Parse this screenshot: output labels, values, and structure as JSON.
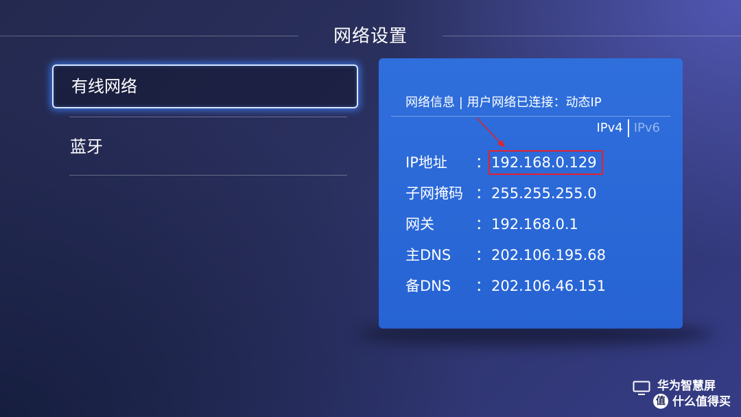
{
  "header": {
    "title": "网络设置"
  },
  "menu": {
    "items": [
      {
        "label": "有线网络",
        "selected": true
      },
      {
        "label": "蓝牙",
        "selected": false
      }
    ]
  },
  "info_panel": {
    "header_text": "网络信息 | 用户网络已连接：动态IP",
    "tabs": [
      {
        "label": "IPv4",
        "active": true
      },
      {
        "label": "IPv6",
        "active": false
      }
    ],
    "rows": [
      {
        "label": "IP地址",
        "colon": "：",
        "value": "192.168.0.129"
      },
      {
        "label": "子网掩码",
        "colon": "：",
        "value": "255.255.255.0"
      },
      {
        "label": "网关",
        "colon": "：",
        "value": "192.168.0.1"
      },
      {
        "label": "主DNS",
        "colon": "：",
        "value": "202.106.195.68"
      },
      {
        "label": "备DNS",
        "colon": "：",
        "value": "202.106.46.151"
      }
    ]
  },
  "watermark": {
    "title": "华为智慧屏",
    "badge": "值",
    "subtitle": "什么值得买"
  },
  "colors": {
    "panel_blue": "#2c6ad9",
    "highlight_red": "#e8202a",
    "selection_glow": "#4082ff"
  },
  "icons": {
    "tv": "tv-icon",
    "arrow": "annotation-arrow"
  }
}
